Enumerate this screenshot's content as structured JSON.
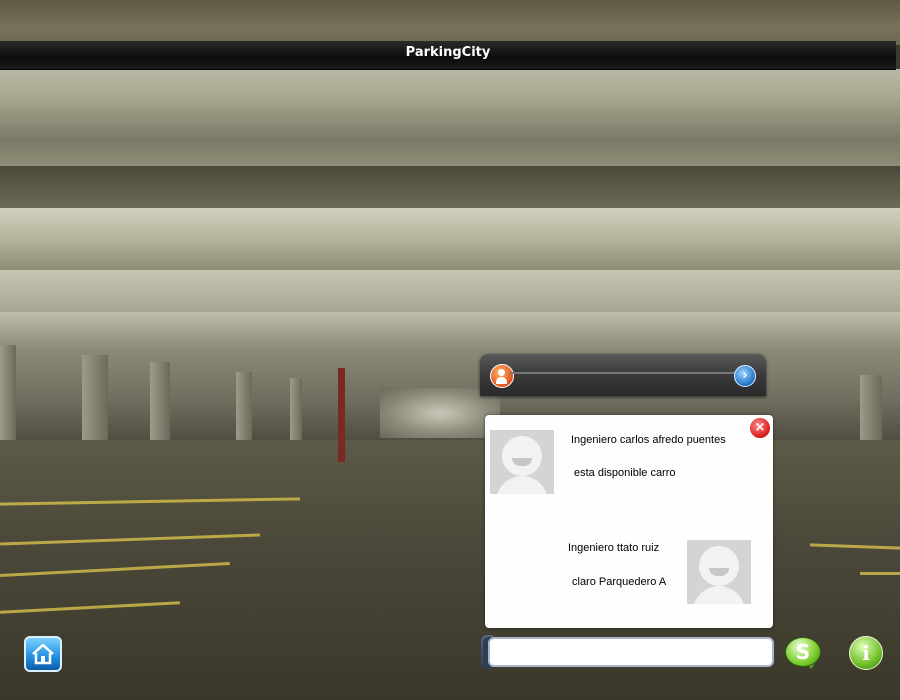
{
  "app": {
    "title": "ParkingCity"
  },
  "user_bar": {
    "user_icon": "user-icon",
    "next_icon": "chevron-right-icon"
  },
  "chat": {
    "close_icon": "close-icon",
    "messages": [
      {
        "side": "left",
        "name": "Ingeniero carlos afredo puentes",
        "text": "esta disponible carro",
        "avatar": "default-avatar"
      },
      {
        "side": "right",
        "name": "Ingeniero ttato ruiz",
        "text": "claro Parquedero A",
        "avatar": "default-avatar"
      }
    ],
    "input_value": "",
    "send_icon": "skype-send-icon"
  },
  "footer": {
    "home_icon": "home-icon",
    "info_icon": "info-icon",
    "info_glyph": "i"
  },
  "colors": {
    "title_bar": "#111111",
    "panel_bg": "#fefefe",
    "close": "#d61c1c",
    "next": "#1f73c9",
    "send": "#7bcc2c",
    "info": "#72c02a",
    "home": "#1f8fe0"
  }
}
